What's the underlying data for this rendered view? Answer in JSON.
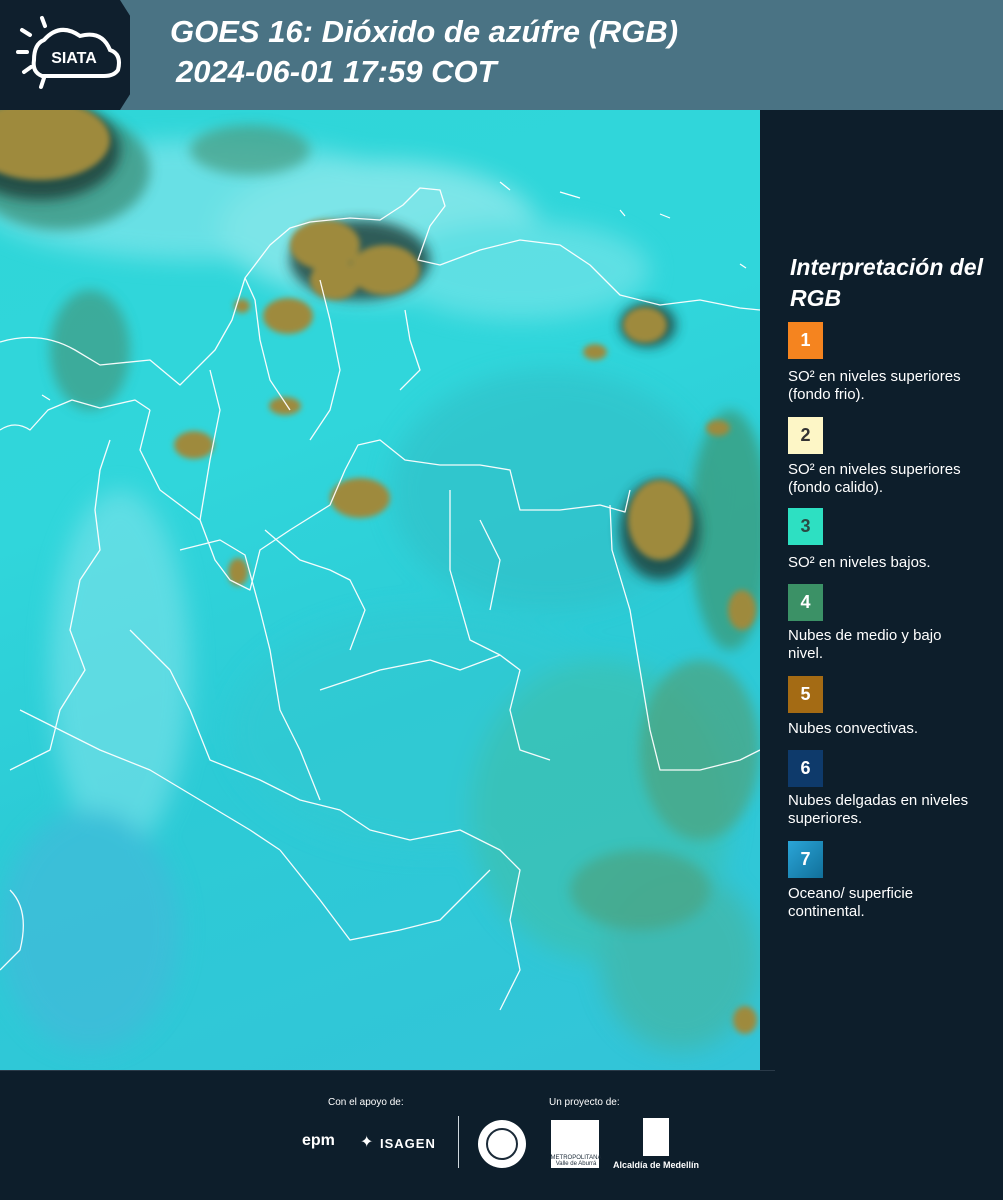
{
  "header": {
    "title_line1": "GOES 16: Dióxido de azúfre (RGB)",
    "title_line2": "2024-06-01 17:59 COT",
    "logo_text": "SIATA",
    "header_color": "#4a7384",
    "dark_color": "#0f1f2d"
  },
  "legend": {
    "title": "Interpretación del RGB",
    "items": [
      {
        "number": "1",
        "text": "SO² en niveles superiores (fondo frio).",
        "color": "#f5841f"
      },
      {
        "number": "2",
        "text": "SO² en niveles superiores (fondo calido).",
        "color": "#fdf6c6"
      },
      {
        "number": "3",
        "text": "SO² en niveles bajos.",
        "color": "#2de0c2"
      },
      {
        "number": "4",
        "text": "Nubes de medio y bajo nivel.",
        "color": "#3b9166"
      },
      {
        "number": "5",
        "text": "Nubes convectivas.",
        "color": "#a46b14"
      },
      {
        "number": "6",
        "text": "Nubes delgadas en niveles superiores.",
        "color": "#0e3a6b"
      },
      {
        "number": "7",
        "text": "Oceano/ superficie continental.",
        "color": "#1e8fbf"
      }
    ]
  },
  "footer": {
    "support_caption": "Con el apoyo de:",
    "project_caption": "Un proyecto de:",
    "sponsor_epm": "epm",
    "sponsor_isagen": "ISAGEN",
    "area_caption": "METROPOLITANA Valle de Aburrá",
    "alcaldia": "Alcaldía de Medellín"
  }
}
